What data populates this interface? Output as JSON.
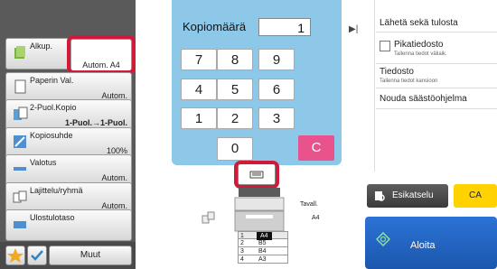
{
  "left_panel": {
    "settings": [
      {
        "title": "Alkup.",
        "value": "Autom.  A4"
      },
      {
        "title": "Paperin Val.",
        "value": "Autom."
      },
      {
        "title": "2-Puol.Kopio",
        "value": "1-Puol.→1-Puol."
      },
      {
        "title": "Kopiosuhde",
        "value": "100%"
      },
      {
        "title": "Valotus",
        "value": "Autom."
      },
      {
        "title": "Lajittelu/ryhmä",
        "value": "Autom."
      },
      {
        "title": "Ulostulotaso",
        "value": ""
      }
    ],
    "muut_label": "Muut"
  },
  "keypad": {
    "label": "Kopiomäärä",
    "value": "1",
    "keys": [
      "7",
      "8",
      "9",
      "4",
      "5",
      "6",
      "1",
      "2",
      "3",
      "0"
    ],
    "clear_label": "C"
  },
  "right_panel": {
    "items": [
      {
        "title": "Lähetä sekä tulosta",
        "sub": ""
      },
      {
        "title": "Pikatiedosto",
        "sub": "Tallenna tiedot väliaik."
      },
      {
        "title": "Tiedosto",
        "sub": "Tallenna tiedot kansioon"
      },
      {
        "title": "Nouda säästöohjelma",
        "sub": ""
      }
    ]
  },
  "machine": {
    "tray_label": "Tavall.",
    "paper_label": "A4",
    "trays": [
      {
        "num": "1",
        "size": "A4"
      },
      {
        "num": "2",
        "size": "B5"
      },
      {
        "num": "3",
        "size": "B4"
      },
      {
        "num": "4",
        "size": "A3"
      }
    ]
  },
  "actions": {
    "preview_label": "Esikatselu",
    "ca_label": "CA",
    "start_label": "Aloita"
  },
  "colors": {
    "keypad_bg": "#8ec8e8",
    "clear_key": "#e8538d",
    "ca_button": "#ffd200",
    "start_button": "#2c73d6",
    "highlight": "#d01a3a"
  }
}
